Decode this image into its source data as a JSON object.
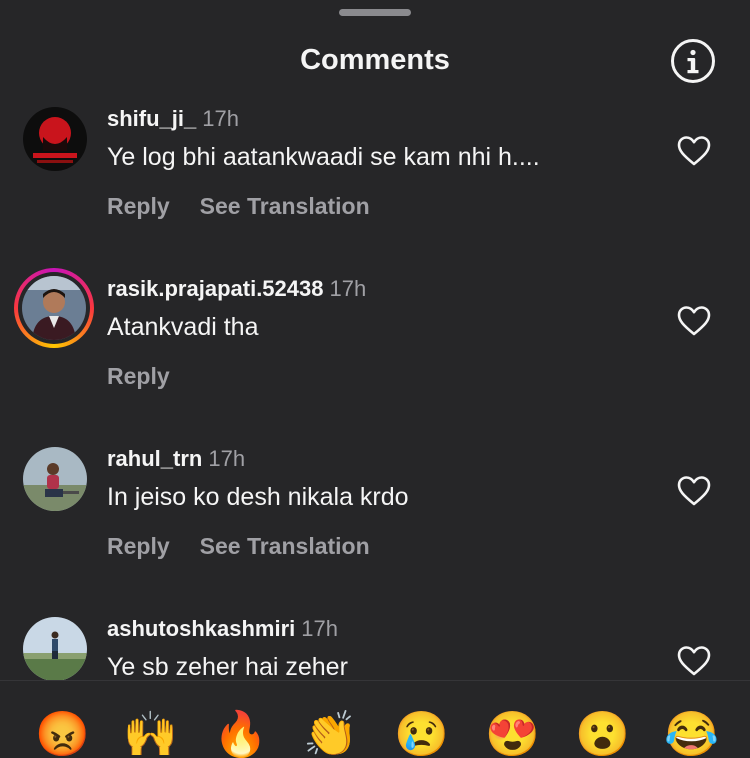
{
  "header": {
    "title": "Comments"
  },
  "comments": [
    {
      "username": "shifu_ji_",
      "time": "17h",
      "text": "Ye log bhi aatankwaadi se kam nhi h....",
      "reply": "Reply",
      "translate": "See Translation"
    },
    {
      "username": "rasik.prajapati.52438",
      "time": "17h",
      "text": "Atankvadi tha",
      "reply": "Reply"
    },
    {
      "username": "rahul_trn",
      "time": "17h",
      "text": "In jeiso ko desh nikala krdo",
      "reply": "Reply",
      "translate": "See Translation"
    },
    {
      "username": "ashutoshkashmiri",
      "time": "17h",
      "text": "Ye sb zeher hai zeher"
    }
  ],
  "reactions": [
    {
      "emoji": "😡",
      "icon": "angry-face-icon"
    },
    {
      "emoji": "🙌",
      "icon": "raised-hands-icon"
    },
    {
      "emoji": "🔥",
      "icon": "fire-icon"
    },
    {
      "emoji": "👏",
      "icon": "clapping-hands-icon"
    },
    {
      "emoji": "😢",
      "icon": "crying-face-icon"
    },
    {
      "emoji": "😍",
      "icon": "heart-eyes-icon"
    },
    {
      "emoji": "😮",
      "icon": "surprised-face-icon"
    },
    {
      "emoji": "😂",
      "icon": "tears-of-joy-icon"
    }
  ]
}
